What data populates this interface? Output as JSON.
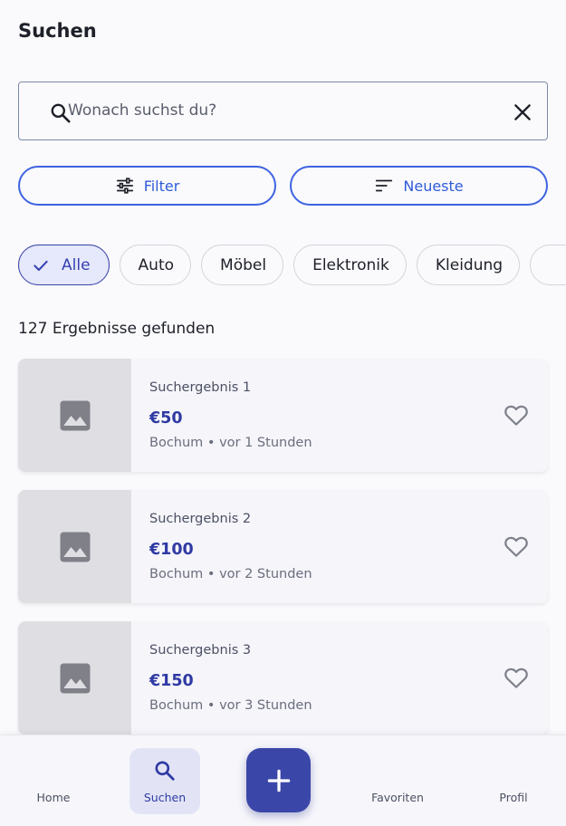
{
  "header": {
    "title": "Suchen"
  },
  "search": {
    "placeholder": "Wonach suchst du?",
    "value": ""
  },
  "actions": {
    "filter_label": "Filter",
    "sort_label": "Neueste"
  },
  "categories": [
    {
      "label": "Alle",
      "selected": true
    },
    {
      "label": "Auto",
      "selected": false
    },
    {
      "label": "Möbel",
      "selected": false
    },
    {
      "label": "Elektronik",
      "selected": false
    },
    {
      "label": "Kleidung",
      "selected": false
    },
    {
      "label": "",
      "selected": false
    }
  ],
  "results": {
    "count_text": "127 Ergebnisse gefunden",
    "items": [
      {
        "title": "Suchergebnis 1",
        "price": "€50",
        "meta": "Bochum • vor 1 Stunden",
        "favorited": false
      },
      {
        "title": "Suchergebnis 2",
        "price": "€100",
        "meta": "Bochum • vor 2 Stunden",
        "favorited": false
      },
      {
        "title": "Suchergebnis 3",
        "price": "€150",
        "meta": "Bochum • vor 3 Stunden",
        "favorited": false
      }
    ]
  },
  "bottom_nav": {
    "items": [
      {
        "label": "Home",
        "icon": "home-icon",
        "active": false
      },
      {
        "label": "Suchen",
        "icon": "search-icon",
        "active": true
      },
      {
        "label": "Favoriten",
        "icon": "heart-icon",
        "active": false
      },
      {
        "label": "Profil",
        "icon": "person-icon",
        "active": false
      }
    ],
    "fab_icon": "plus-icon"
  },
  "colors": {
    "accent": "#2f3aa3",
    "outline_accent": "#3d63e0",
    "selected_chip_bg": "#e6e8fb",
    "fab_bg": "#3b47a8",
    "thumb_bg": "#dfdfe3"
  }
}
